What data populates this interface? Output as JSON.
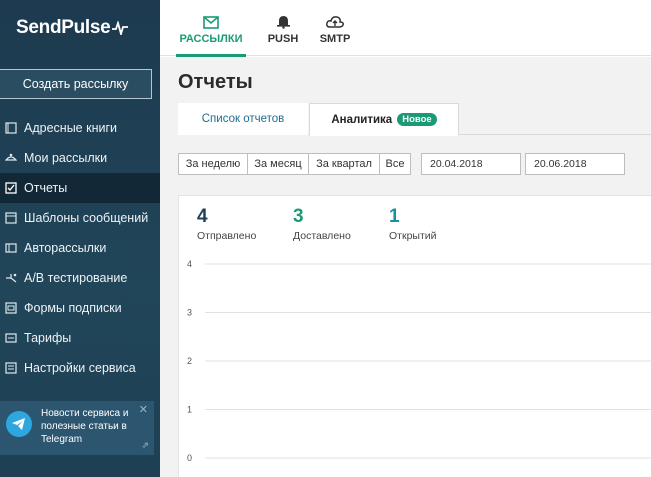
{
  "brand": {
    "name": "SendPulse"
  },
  "sidebar": {
    "create_button": "Создать рассылку",
    "items": [
      {
        "label": "Адресные книги",
        "icon": "address-book-icon"
      },
      {
        "label": "Мои рассылки",
        "icon": "megaphone-icon"
      },
      {
        "label": "Отчеты",
        "icon": "checkbox-icon"
      },
      {
        "label": "Шаблоны сообщений",
        "icon": "template-icon"
      },
      {
        "label": "Авторассылки",
        "icon": "auto-icon"
      },
      {
        "label": "A/B тестирование",
        "icon": "ab-icon"
      },
      {
        "label": "Формы подписки",
        "icon": "form-icon"
      },
      {
        "label": "Тарифы",
        "icon": "tariff-icon"
      },
      {
        "label": "Настройки сервиса",
        "icon": "settings-icon"
      }
    ],
    "telegram": {
      "text": "Новости сервиса и полезные статьи в Telegram",
      "close": "✕",
      "ext": "⇗"
    }
  },
  "topbar": {
    "tabs": [
      {
        "label": "РАССЫЛКИ",
        "icon": "mail-icon"
      },
      {
        "label": "PUSH",
        "icon": "bell-icon"
      },
      {
        "label": "SMTP",
        "icon": "cloud-icon"
      }
    ]
  },
  "main": {
    "title": "Отчеты",
    "tabs": [
      {
        "label": "Список отчетов"
      },
      {
        "label": "Аналитика",
        "badge": "Новое"
      }
    ],
    "periods": [
      "За неделю",
      "За месяц",
      "За квартал",
      "Все"
    ],
    "date_from": "20.04.2018",
    "date_to": "20.06.2018",
    "stats": [
      {
        "value": "4",
        "label": "Отправлено",
        "color": "#1f3f57"
      },
      {
        "value": "3",
        "label": "Доставлено",
        "color": "#1a9b75"
      },
      {
        "value": "1",
        "label": "Открытий",
        "color": "#1a8fa0"
      }
    ]
  },
  "chart_data": {
    "type": "line",
    "yticks": [
      "4",
      "3",
      "2",
      "1",
      "0"
    ],
    "ylim": [
      0,
      4
    ],
    "grid": true,
    "series": []
  }
}
